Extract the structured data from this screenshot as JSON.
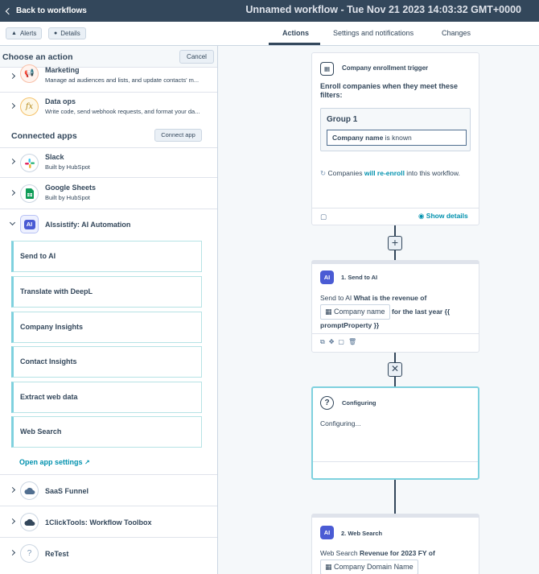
{
  "topbar": {
    "back_label": "Back to workflows",
    "workflow_title": "Unnamed workflow - Tue Nov 21 2023 14:03:32 GMT+0000"
  },
  "subbar": {
    "alerts_label": "Alerts",
    "details_label": "Details",
    "tabs": [
      {
        "label": "Actions",
        "active": true
      },
      {
        "label": "Settings and notifications",
        "active": false
      },
      {
        "label": "Changes",
        "active": false
      }
    ]
  },
  "panel": {
    "title": "Choose an action",
    "cancel_label": "Cancel",
    "categories": [
      {
        "name": "Marketing",
        "desc": "Manage ad audiences and lists, and update contacts' m...",
        "icon": "megaphone-icon"
      },
      {
        "name": "Data ops",
        "desc": "Write code, send webhook requests, and format your da...",
        "icon": "fx-icon"
      }
    ],
    "connected_title": "Connected apps",
    "connect_app_label": "Connect app",
    "apps": [
      {
        "name": "Slack",
        "desc": "Built by HubSpot",
        "icon": "slack-icon"
      },
      {
        "name": "Google Sheets",
        "desc": "Built by HubSpot",
        "icon": "google-sheets-icon"
      },
      {
        "name": "AIssistify: AI Automation",
        "desc": "",
        "icon": "ai-icon"
      }
    ],
    "actions": [
      "Send to AI",
      "Translate with DeepL",
      "Company Insights",
      "Contact Insights",
      "Extract web data",
      "Web Search"
    ],
    "open_settings_label": "Open app settings",
    "more_apps": [
      {
        "name": "SaaS Funnel",
        "icon": "cloud-icon"
      },
      {
        "name": "1ClickTools: Workflow Toolbox",
        "icon": "cloud-icon"
      },
      {
        "name": "ReTest",
        "icon": "question-icon"
      }
    ]
  },
  "canvas": {
    "trigger": {
      "header": "Company enrollment trigger",
      "enroll_text": "Enroll companies when they meet these filters:",
      "group_label": "Group 1",
      "filter_prop": "Company name",
      "filter_rest": " is known",
      "reenroll_pre": "Companies ",
      "reenroll_link": "will re-enroll",
      "reenroll_post": " into this workflow.",
      "show_details": "Show details"
    },
    "step1": {
      "header": "1. Send to AI",
      "text_pre": "Send to AI ",
      "text_bold": "What is the revenue of",
      "chip": "Company name",
      "text_bold2": " for the last year  {{",
      "text_bold3": "promptProperty }}"
    },
    "configuring": {
      "header": "Configuring",
      "body": "Configuring..."
    },
    "step2": {
      "header": "2. Web Search",
      "text_pre": "Web Search ",
      "text_bold": "Revenue for 2023 FY of",
      "chip": "Company Domain Name"
    }
  },
  "colors": {
    "topbar": "#33475b",
    "accent": "#0091ae",
    "teal_border": "#7fd1de"
  }
}
